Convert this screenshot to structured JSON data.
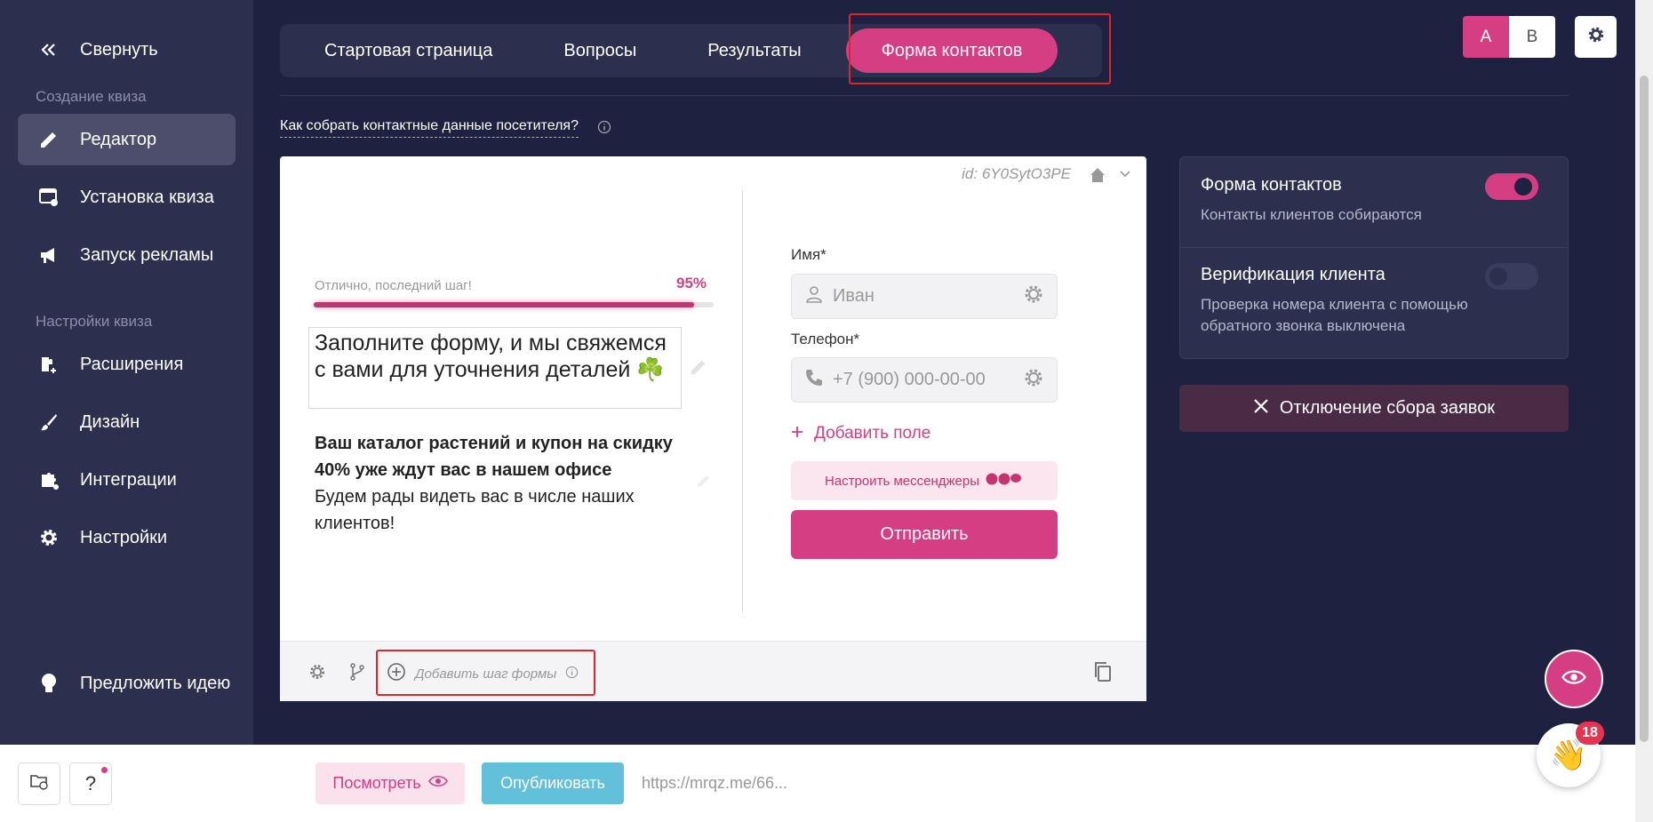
{
  "sidebar": {
    "collapse_label": "Свернуть",
    "section_create": "Создание квиза",
    "items_create": [
      {
        "label": "Редактор",
        "icon": "pencil-icon",
        "active": true
      },
      {
        "label": "Установка квиза",
        "icon": "install-icon"
      },
      {
        "label": "Запуск рекламы",
        "icon": "megaphone-icon"
      }
    ],
    "section_settings": "Настройки квиза",
    "items_settings": [
      {
        "label": "Расширения",
        "icon": "extension-icon"
      },
      {
        "label": "Дизайн",
        "icon": "brush-icon"
      },
      {
        "label": "Интеграции",
        "icon": "integration-icon"
      },
      {
        "label": "Настройки",
        "icon": "gear-icon"
      }
    ],
    "suggest_label": "Предложить идею"
  },
  "tabs": [
    {
      "label": "Стартовая страница"
    },
    {
      "label": "Вопросы"
    },
    {
      "label": "Результаты"
    },
    {
      "label": "Форма контактов",
      "active": true
    }
  ],
  "ab": {
    "a": "A",
    "b": "B"
  },
  "howto": "Как собрать контактные данные посетителя?",
  "card": {
    "id": "id: 6Y0SytO3PE",
    "progress_label": "Отлично, последний шаг!",
    "progress_pct": "95%",
    "progress_value": 0.95,
    "heading": "Заполните форму, и мы свяжемся с вами для уточнения деталей ☘️",
    "desc_bold": "Ваш каталог растений и купон на скидку 40% уже ждут вас в нашем офисе",
    "desc": "Будем рады видеть вас в числе наших клиентов!",
    "name_label": "Имя*",
    "name_placeholder": "Иван",
    "phone_label": "Телефон*",
    "phone_placeholder": "+7 (900) 000-00-00",
    "add_field": "Добавить поле",
    "messengers": "Настроить мессенджеры",
    "submit": "Отправить",
    "add_step": "Добавить шаг формы"
  },
  "right_panel": {
    "contact_form_title": "Форма контактов",
    "contact_form_sub": "Контакты клиентов собираются",
    "contact_form_on": true,
    "verify_title": "Верификация клиента",
    "verify_sub": "Проверка номера клиента с помощью обратного звонка выключена",
    "verify_on": false,
    "disable_btn": "Отключение сбора заявок"
  },
  "bottom": {
    "help": "?",
    "view_label": "Посмотреть",
    "publish_label": "Опубликовать",
    "url": "https://mrqz.me/66..."
  },
  "notifications_count": "18",
  "colors": {
    "accent": "#d53e83",
    "sidebar": "#2d2f4e",
    "background": "#1f2140",
    "publish": "#62c0da"
  }
}
